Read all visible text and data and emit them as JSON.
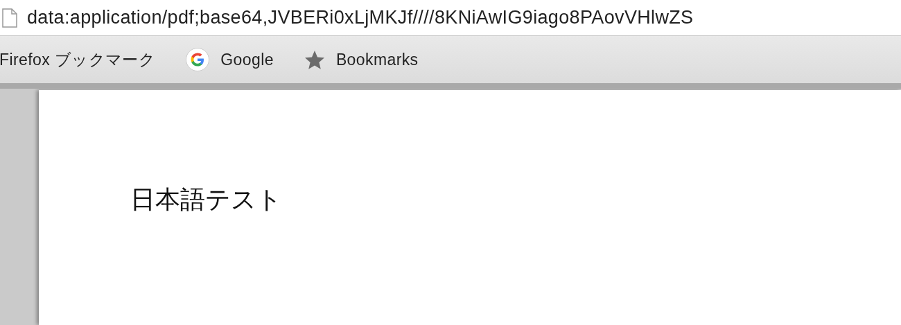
{
  "address_bar": {
    "url": "data:application/pdf;base64,JVBERi0xLjMKJf////8KNiAwIG9iago8PAovVHlwZS"
  },
  "bookmarks_bar": {
    "items": [
      {
        "kind": "plain",
        "label": "Firefox ブックマーク"
      },
      {
        "kind": "google",
        "label": "Google"
      },
      {
        "kind": "star",
        "label": "Bookmarks"
      }
    ]
  },
  "document": {
    "text": "日本語テスト"
  }
}
